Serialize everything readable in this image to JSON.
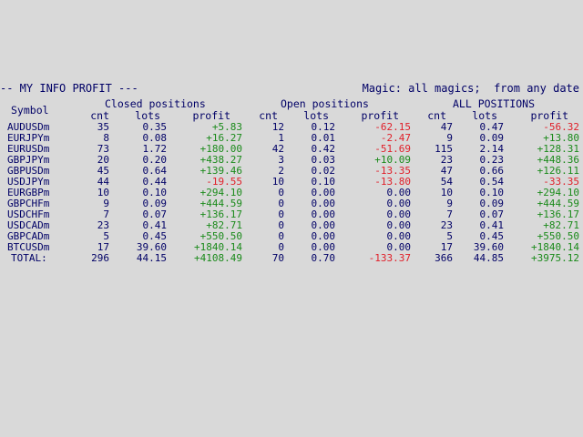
{
  "header": {
    "title": "-- MY INFO PROFIT ---",
    "filter": "Magic: all magics;  from any date"
  },
  "groups": {
    "closed": "Closed positions",
    "open": "Open positions",
    "all": "ALL POSITIONS"
  },
  "columns": {
    "symbol": "Symbol",
    "cnt": "cnt",
    "lots": "lots",
    "profit": "profit"
  },
  "rows": [
    {
      "symbol": "AUDUSDm",
      "c_cnt": "35",
      "c_lots": "0.35",
      "c_profit": "+5.83",
      "o_cnt": "12",
      "o_lots": "0.12",
      "o_profit": "-62.15",
      "a_cnt": "47",
      "a_lots": "0.47",
      "a_profit": "-56.32"
    },
    {
      "symbol": "EURJPYm",
      "c_cnt": "8",
      "c_lots": "0.08",
      "c_profit": "+16.27",
      "o_cnt": "1",
      "o_lots": "0.01",
      "o_profit": "-2.47",
      "a_cnt": "9",
      "a_lots": "0.09",
      "a_profit": "+13.80"
    },
    {
      "symbol": "EURUSDm",
      "c_cnt": "73",
      "c_lots": "1.72",
      "c_profit": "+180.00",
      "o_cnt": "42",
      "o_lots": "0.42",
      "o_profit": "-51.69",
      "a_cnt": "115",
      "a_lots": "2.14",
      "a_profit": "+128.31"
    },
    {
      "symbol": "GBPJPYm",
      "c_cnt": "20",
      "c_lots": "0.20",
      "c_profit": "+438.27",
      "o_cnt": "3",
      "o_lots": "0.03",
      "o_profit": "+10.09",
      "a_cnt": "23",
      "a_lots": "0.23",
      "a_profit": "+448.36"
    },
    {
      "symbol": "GBPUSDm",
      "c_cnt": "45",
      "c_lots": "0.64",
      "c_profit": "+139.46",
      "o_cnt": "2",
      "o_lots": "0.02",
      "o_profit": "-13.35",
      "a_cnt": "47",
      "a_lots": "0.66",
      "a_profit": "+126.11"
    },
    {
      "symbol": "USDJPYm",
      "c_cnt": "44",
      "c_lots": "0.44",
      "c_profit": "-19.55",
      "o_cnt": "10",
      "o_lots": "0.10",
      "o_profit": "-13.80",
      "a_cnt": "54",
      "a_lots": "0.54",
      "a_profit": "-33.35"
    },
    {
      "symbol": "EURGBPm",
      "c_cnt": "10",
      "c_lots": "0.10",
      "c_profit": "+294.10",
      "o_cnt": "0",
      "o_lots": "0.00",
      "o_profit": "0.00",
      "a_cnt": "10",
      "a_lots": "0.10",
      "a_profit": "+294.10"
    },
    {
      "symbol": "GBPCHFm",
      "c_cnt": "9",
      "c_lots": "0.09",
      "c_profit": "+444.59",
      "o_cnt": "0",
      "o_lots": "0.00",
      "o_profit": "0.00",
      "a_cnt": "9",
      "a_lots": "0.09",
      "a_profit": "+444.59"
    },
    {
      "symbol": "USDCHFm",
      "c_cnt": "7",
      "c_lots": "0.07",
      "c_profit": "+136.17",
      "o_cnt": "0",
      "o_lots": "0.00",
      "o_profit": "0.00",
      "a_cnt": "7",
      "a_lots": "0.07",
      "a_profit": "+136.17"
    },
    {
      "symbol": "USDCADm",
      "c_cnt": "23",
      "c_lots": "0.41",
      "c_profit": "+82.71",
      "o_cnt": "0",
      "o_lots": "0.00",
      "o_profit": "0.00",
      "a_cnt": "23",
      "a_lots": "0.41",
      "a_profit": "+82.71"
    },
    {
      "symbol": "GBPCADm",
      "c_cnt": "5",
      "c_lots": "0.45",
      "c_profit": "+550.50",
      "o_cnt": "0",
      "o_lots": "0.00",
      "o_profit": "0.00",
      "a_cnt": "5",
      "a_lots": "0.45",
      "a_profit": "+550.50"
    },
    {
      "symbol": "BTCUSDm",
      "c_cnt": "17",
      "c_lots": "39.60",
      "c_profit": "+1840.14",
      "o_cnt": "0",
      "o_lots": "0.00",
      "o_profit": "0.00",
      "a_cnt": "17",
      "a_lots": "39.60",
      "a_profit": "+1840.14"
    }
  ],
  "total": {
    "symbol": "TOTAL:",
    "c_cnt": "296",
    "c_lots": "44.15",
    "c_profit": "+4108.49",
    "o_cnt": "70",
    "o_lots": "0.70",
    "o_profit": "-133.37",
    "a_cnt": "366",
    "a_lots": "44.85",
    "a_profit": "+3975.12"
  },
  "colors": {
    "text": "#000066",
    "positive": "#1a8a1a",
    "negative": "#e0202a",
    "background": "#d9d9d9"
  }
}
